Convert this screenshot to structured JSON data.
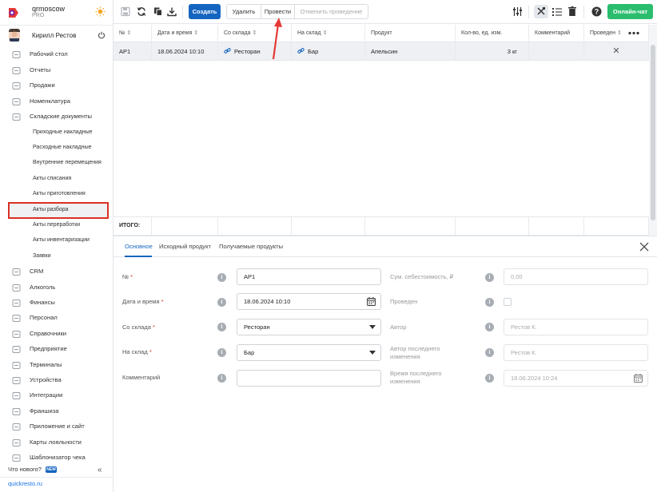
{
  "brand": {
    "name": "qrmoscow",
    "plan": "PRO"
  },
  "user": {
    "name": "Кирилл Рестов"
  },
  "nav": {
    "items": [
      {
        "label": "Рабочий стол",
        "icon": "dashboard-icon"
      },
      {
        "label": "Отчеты",
        "icon": "reports-icon"
      },
      {
        "label": "Продажи",
        "icon": "sales-icon"
      },
      {
        "label": "Номенклатура",
        "icon": "nomenclature-icon"
      },
      {
        "label": "Складские документы",
        "icon": "warehouse-icon"
      }
    ],
    "sub_items": [
      {
        "label": "Приходные накладные"
      },
      {
        "label": "Расходные накладные"
      },
      {
        "label": "Внутренние перемещения"
      },
      {
        "label": "Акты списания"
      },
      {
        "label": "Акты приготовления"
      },
      {
        "label": "Акты разбора"
      },
      {
        "label": "Акты переработки"
      },
      {
        "label": "Акты инвентаризации"
      },
      {
        "label": "Заявки"
      }
    ],
    "items2": [
      {
        "label": "CRM",
        "icon": "crm-icon"
      },
      {
        "label": "Алкоголь",
        "icon": "alcohol-icon"
      },
      {
        "label": "Финансы",
        "icon": "finance-icon"
      },
      {
        "label": "Персонал",
        "icon": "staff-icon"
      },
      {
        "label": "Справочники",
        "icon": "reference-icon"
      },
      {
        "label": "Предприятие",
        "icon": "enterprise-icon"
      },
      {
        "label": "Терминалы",
        "icon": "terminal-icon"
      },
      {
        "label": "Устройства",
        "icon": "devices-icon"
      },
      {
        "label": "Интеграции",
        "icon": "integrations-icon"
      },
      {
        "label": "Франшиза",
        "icon": "franchise-icon"
      },
      {
        "label": "Приложение и сайт",
        "icon": "app-site-icon"
      },
      {
        "label": "Карты лояльности",
        "icon": "loyalty-icon"
      },
      {
        "label": "Шаблонизатор чека",
        "icon": "receipt-template-icon"
      }
    ],
    "whats_new": "Что нового?",
    "new_badge": "NEW",
    "site": "quickresto.ru"
  },
  "toolbar": {
    "create": "Создать",
    "delete": "Удалить",
    "post": "Провести",
    "unpost": "Отменить проведение",
    "chat": "Онлайн-чат"
  },
  "table": {
    "headers": [
      "№",
      "Дата и время",
      "Со склада",
      "На склад",
      "Продукт",
      "Кол-во, ед. изм.",
      "Комментарий",
      "Проведен"
    ],
    "sort_mark": "⇕",
    "rows": [
      {
        "num": "АР1",
        "date": "18.06.2024 10:10",
        "from": "Ресторан",
        "to": "Бар",
        "product": "Апельсин",
        "qty": "3 кг",
        "comment": "",
        "posted": "✕"
      }
    ],
    "totals_label": "ИТОГО:"
  },
  "form": {
    "tabs": [
      "Основное",
      "Исходный продукт",
      "Получаемые продукты"
    ],
    "fields": {
      "num": {
        "label": "№",
        "value": "АР1"
      },
      "date": {
        "label": "Дата и время",
        "value": "18.06.2024 10:10"
      },
      "from": {
        "label": "Со склада",
        "value": "Ресторан"
      },
      "to": {
        "label": "На склад",
        "value": "Бар"
      },
      "comment": {
        "label": "Комментарий",
        "value": ""
      },
      "cost": {
        "label": "Сум. себестоимость, ₽",
        "value": "0,00"
      },
      "posted": {
        "label": "Проведен"
      },
      "author": {
        "label": "Автор",
        "value": "Рестов К."
      },
      "last_author": {
        "label": "Автор последнего изменения",
        "value": "Рестов К."
      },
      "last_time": {
        "label": "Время последнего изменения",
        "value": "18.06.2024 10:24"
      }
    },
    "required_mark": "*"
  },
  "colors": {
    "primary": "#1565c0",
    "chat": "#2bbd6e",
    "highlight": "#d93025",
    "arrow": "#e53935"
  }
}
